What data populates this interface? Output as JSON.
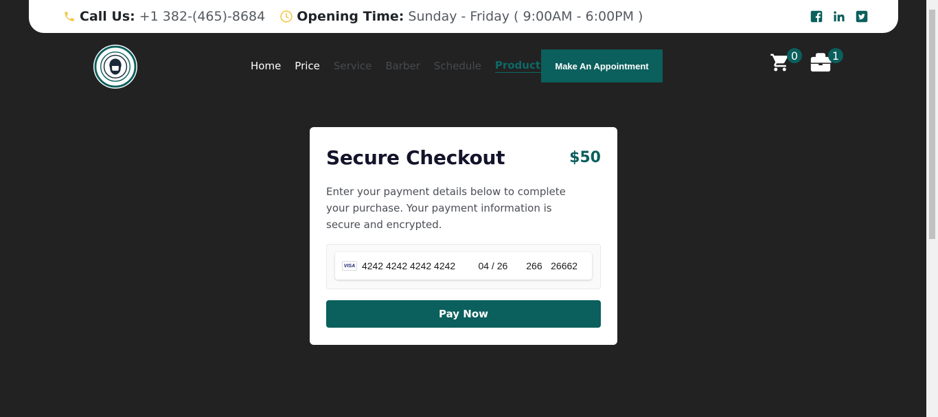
{
  "topbar": {
    "call_label": "Call Us:",
    "phone": "+1 382-(465)-8684",
    "opening_label": "Opening Time:",
    "opening_hours": "Sunday - Friday ( 9:00AM - 6:00PM )",
    "accent_color": "#f2c94c",
    "socials": [
      "facebook-icon",
      "linkedin-icon",
      "twitter-icon"
    ]
  },
  "logo": {
    "alt": "7 Days Barber Shop US"
  },
  "nav": {
    "items": [
      {
        "label": "Home",
        "state": "normal"
      },
      {
        "label": "Price",
        "state": "normal"
      },
      {
        "label": "Service",
        "state": "dim"
      },
      {
        "label": "Barber",
        "state": "dim"
      },
      {
        "label": "Schedule",
        "state": "dim"
      },
      {
        "label": "Products",
        "state": "active"
      }
    ],
    "appointment_label": "Make An Appointment",
    "cart_count": "0",
    "bag_count": "1"
  },
  "checkout": {
    "title": "Secure Checkout",
    "amount": "$50",
    "description": "Enter your payment details below to complete your purchase. Your payment information is secure and encrypted.",
    "card_brand": "VISA",
    "card_number": "4242 4242 4242 4242",
    "expiry": "04 / 26",
    "cvc": "266",
    "zip": "26662",
    "pay_label": "Pay Now"
  },
  "colors": {
    "brand": "#0b5f5c",
    "background": "#222222"
  }
}
